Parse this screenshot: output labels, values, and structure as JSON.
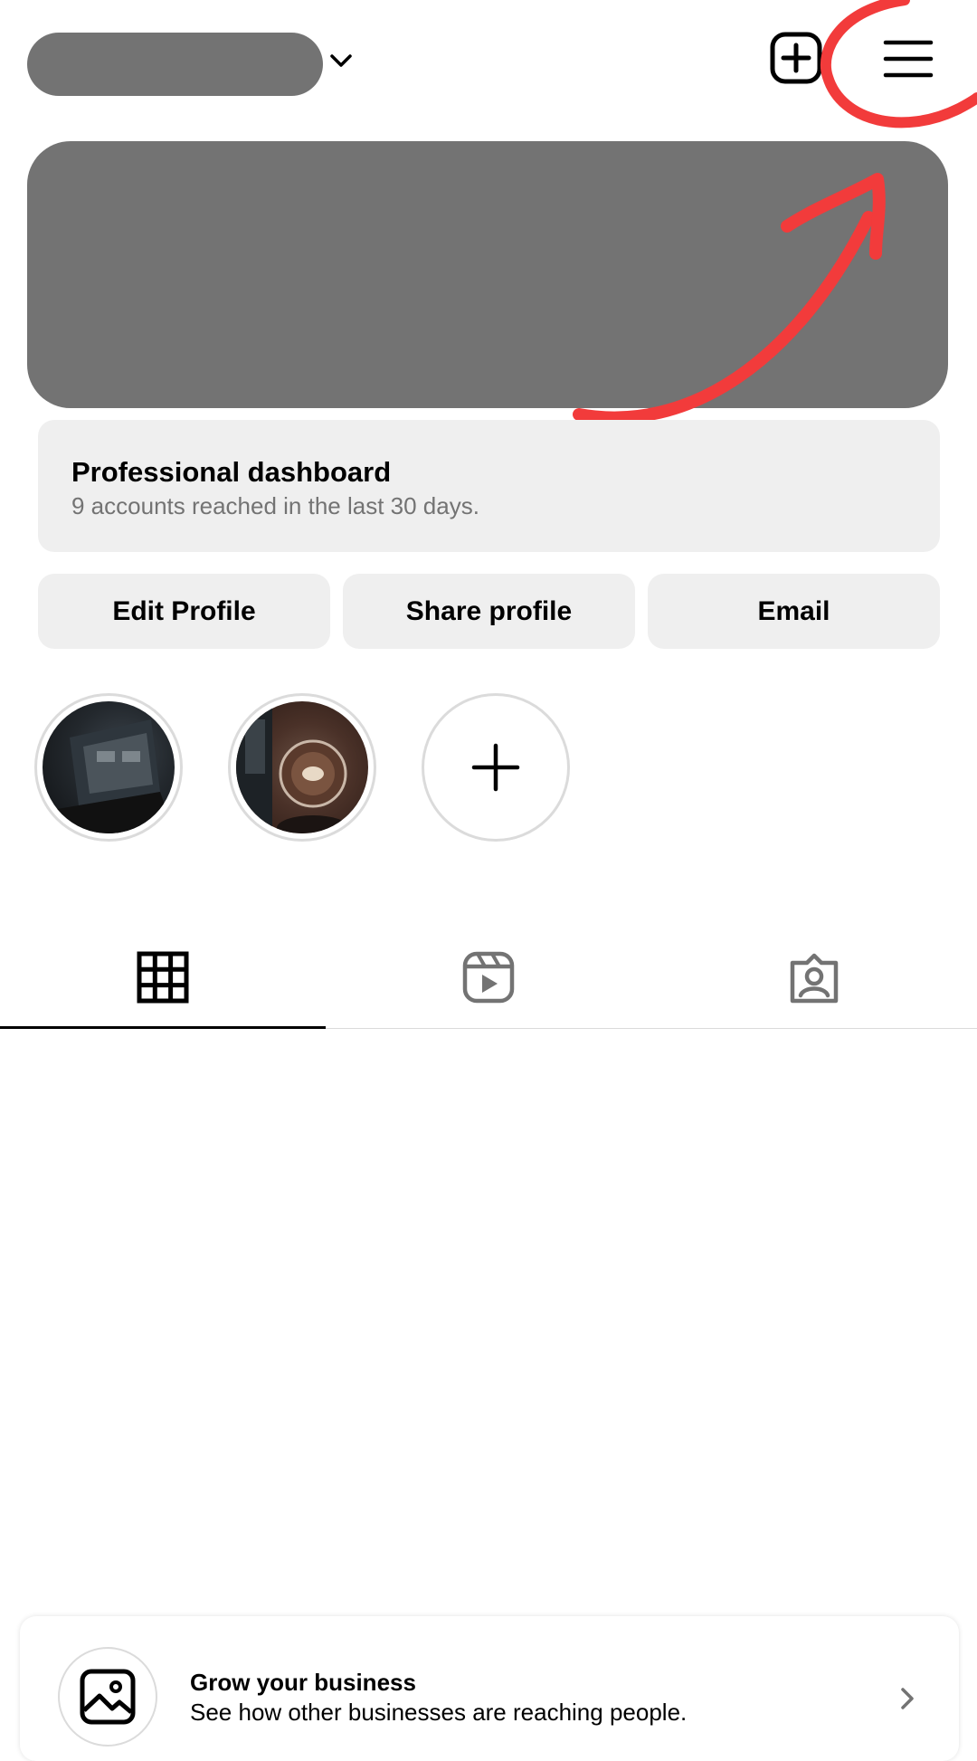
{
  "header": {
    "username_redacted": true,
    "icons": {
      "account_switch": "chevron-down-icon",
      "create": "plus-square-icon",
      "menu": "hamburger-menu-icon"
    }
  },
  "dashboard": {
    "title": "Professional dashboard",
    "subtitle": "9 accounts reached in the last 30 days."
  },
  "actions": {
    "edit_label": "Edit Profile",
    "share_label": "Share profile",
    "email_label": "Email"
  },
  "highlights": [
    {
      "kind": "laptop-photo-thumbnail"
    },
    {
      "kind": "coffee-photo-thumbnail"
    },
    {
      "kind": "new-highlight",
      "icon": "plus-icon"
    }
  ],
  "tabs": [
    {
      "icon": "grid-icon",
      "selected": true
    },
    {
      "icon": "reels-icon",
      "selected": false
    },
    {
      "icon": "tagged-icon",
      "selected": false
    }
  ],
  "promo": {
    "title": "Grow your business",
    "subtitle": "See how other businesses are reaching people."
  },
  "colors": {
    "annotation": "#f23b3b",
    "redaction": "#737373",
    "button_bg": "#efefef"
  }
}
